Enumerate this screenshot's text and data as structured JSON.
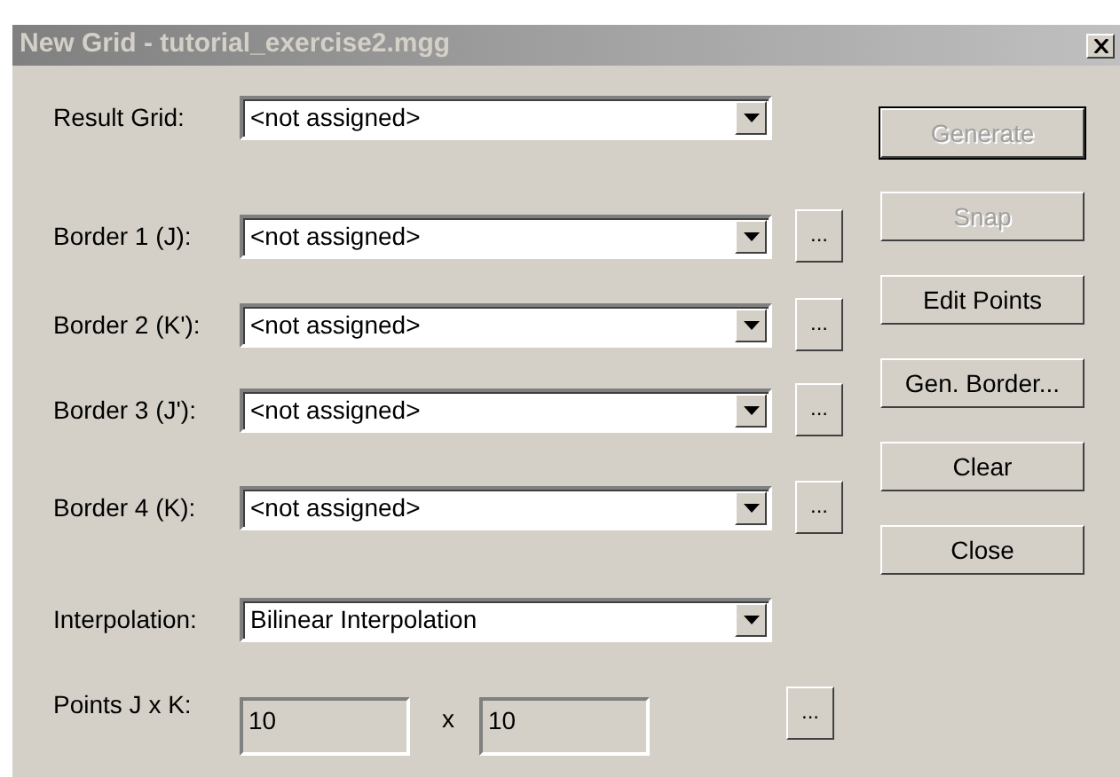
{
  "window": {
    "title": "New Grid - tutorial_exercise2.mgg"
  },
  "fields": [
    {
      "kind": "combo",
      "label": "Result Grid:",
      "value": "<not assigned>"
    },
    {
      "kind": "combo",
      "label": "Border 1 (J):",
      "value": "<not assigned>",
      "browse": "..."
    },
    {
      "kind": "combo",
      "label": "Border 2 (K'):",
      "value": "<not assigned>",
      "browse": "..."
    },
    {
      "kind": "combo",
      "label": "Border 3 (J'):",
      "value": "<not assigned>",
      "browse": "..."
    },
    {
      "kind": "combo",
      "label": "Border 4 (K):",
      "value": "<not assigned>",
      "browse": "..."
    },
    {
      "kind": "combo",
      "label": "Interpolation:",
      "value": "Bilinear Interpolation"
    },
    {
      "kind": "points",
      "label": "Points J x K:",
      "j": "10",
      "separator": "x",
      "k": "10",
      "browse": "..."
    }
  ],
  "buttons": [
    {
      "label": "Generate",
      "disabled": true,
      "default": true
    },
    {
      "label": "Snap",
      "disabled": true,
      "default": false
    },
    {
      "label": "Edit Points",
      "disabled": false,
      "default": false
    },
    {
      "label": "Gen. Border...",
      "disabled": false,
      "default": false
    },
    {
      "label": "Clear",
      "disabled": false,
      "default": false
    },
    {
      "label": "Close",
      "disabled": false,
      "default": false
    }
  ]
}
